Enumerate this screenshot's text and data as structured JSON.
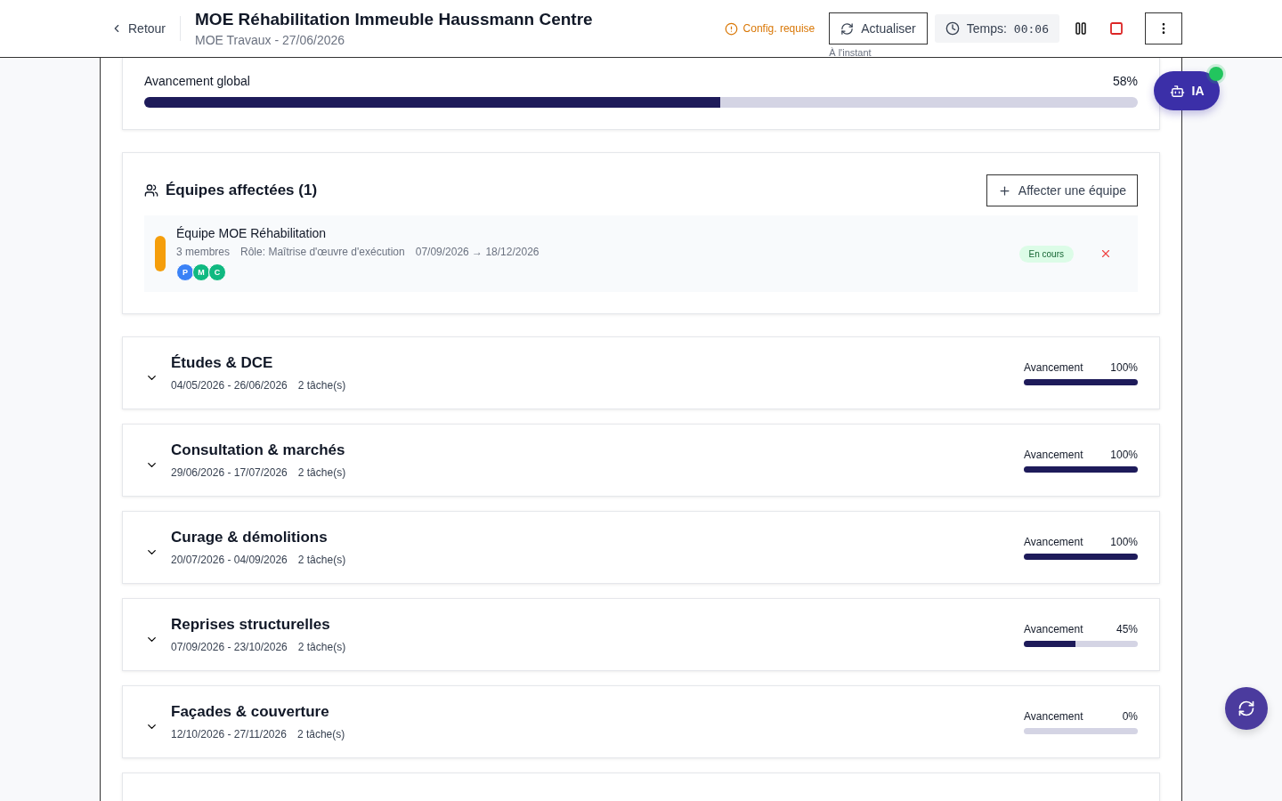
{
  "header": {
    "back": "Retour",
    "title": "MOE Réhabilitation Immeuble Haussmann Centre",
    "subtitle": "MOE Travaux - 27/06/2026",
    "warning": "Config. requise",
    "refresh": "Actualiser",
    "refreshed": "À l'instant",
    "timer_label": "Temps:",
    "timer_value": "00:06"
  },
  "global_progress": {
    "label": "Avancement global",
    "value": "58%",
    "level": 0.58
  },
  "teams": {
    "title": "Équipes affectées (1)",
    "assign_button": "Affecter une équipe",
    "items": [
      {
        "name": "Équipe MOE Réhabilitation",
        "members": "3 membres",
        "role": "Rôle: Maîtrise d'œuvre d'exécution",
        "dates": "07/09/2026 → 18/12/2026",
        "status": "En cours",
        "avatars": [
          {
            "initial": "P",
            "color": "#3b82f6"
          },
          {
            "initial": "M",
            "color": "#10b981"
          },
          {
            "initial": "C",
            "color": "#10b981"
          }
        ]
      }
    ]
  },
  "phases": [
    {
      "title": "Études & DCE",
      "dates": "04/05/2026 - 26/06/2026",
      "tasks": "2 tâche(s)",
      "progress_label": "Avancement",
      "value": "100%",
      "level": 1
    },
    {
      "title": "Consultation & marchés",
      "dates": "29/06/2026 - 17/07/2026",
      "tasks": "2 tâche(s)",
      "progress_label": "Avancement",
      "value": "100%",
      "level": 1
    },
    {
      "title": "Curage & démolitions",
      "dates": "20/07/2026 - 04/09/2026",
      "tasks": "2 tâche(s)",
      "progress_label": "Avancement",
      "value": "100%",
      "level": 1
    },
    {
      "title": "Reprises structurelles",
      "dates": "07/09/2026 - 23/10/2026",
      "tasks": "2 tâche(s)",
      "progress_label": "Avancement",
      "value": "45%",
      "level": 0.45
    },
    {
      "title": "Façades & couverture",
      "dates": "12/10/2026 - 27/11/2026",
      "tasks": "2 tâche(s)",
      "progress_label": "Avancement",
      "value": "0%",
      "level": 0
    }
  ],
  "assistant": {
    "label": "IA"
  }
}
